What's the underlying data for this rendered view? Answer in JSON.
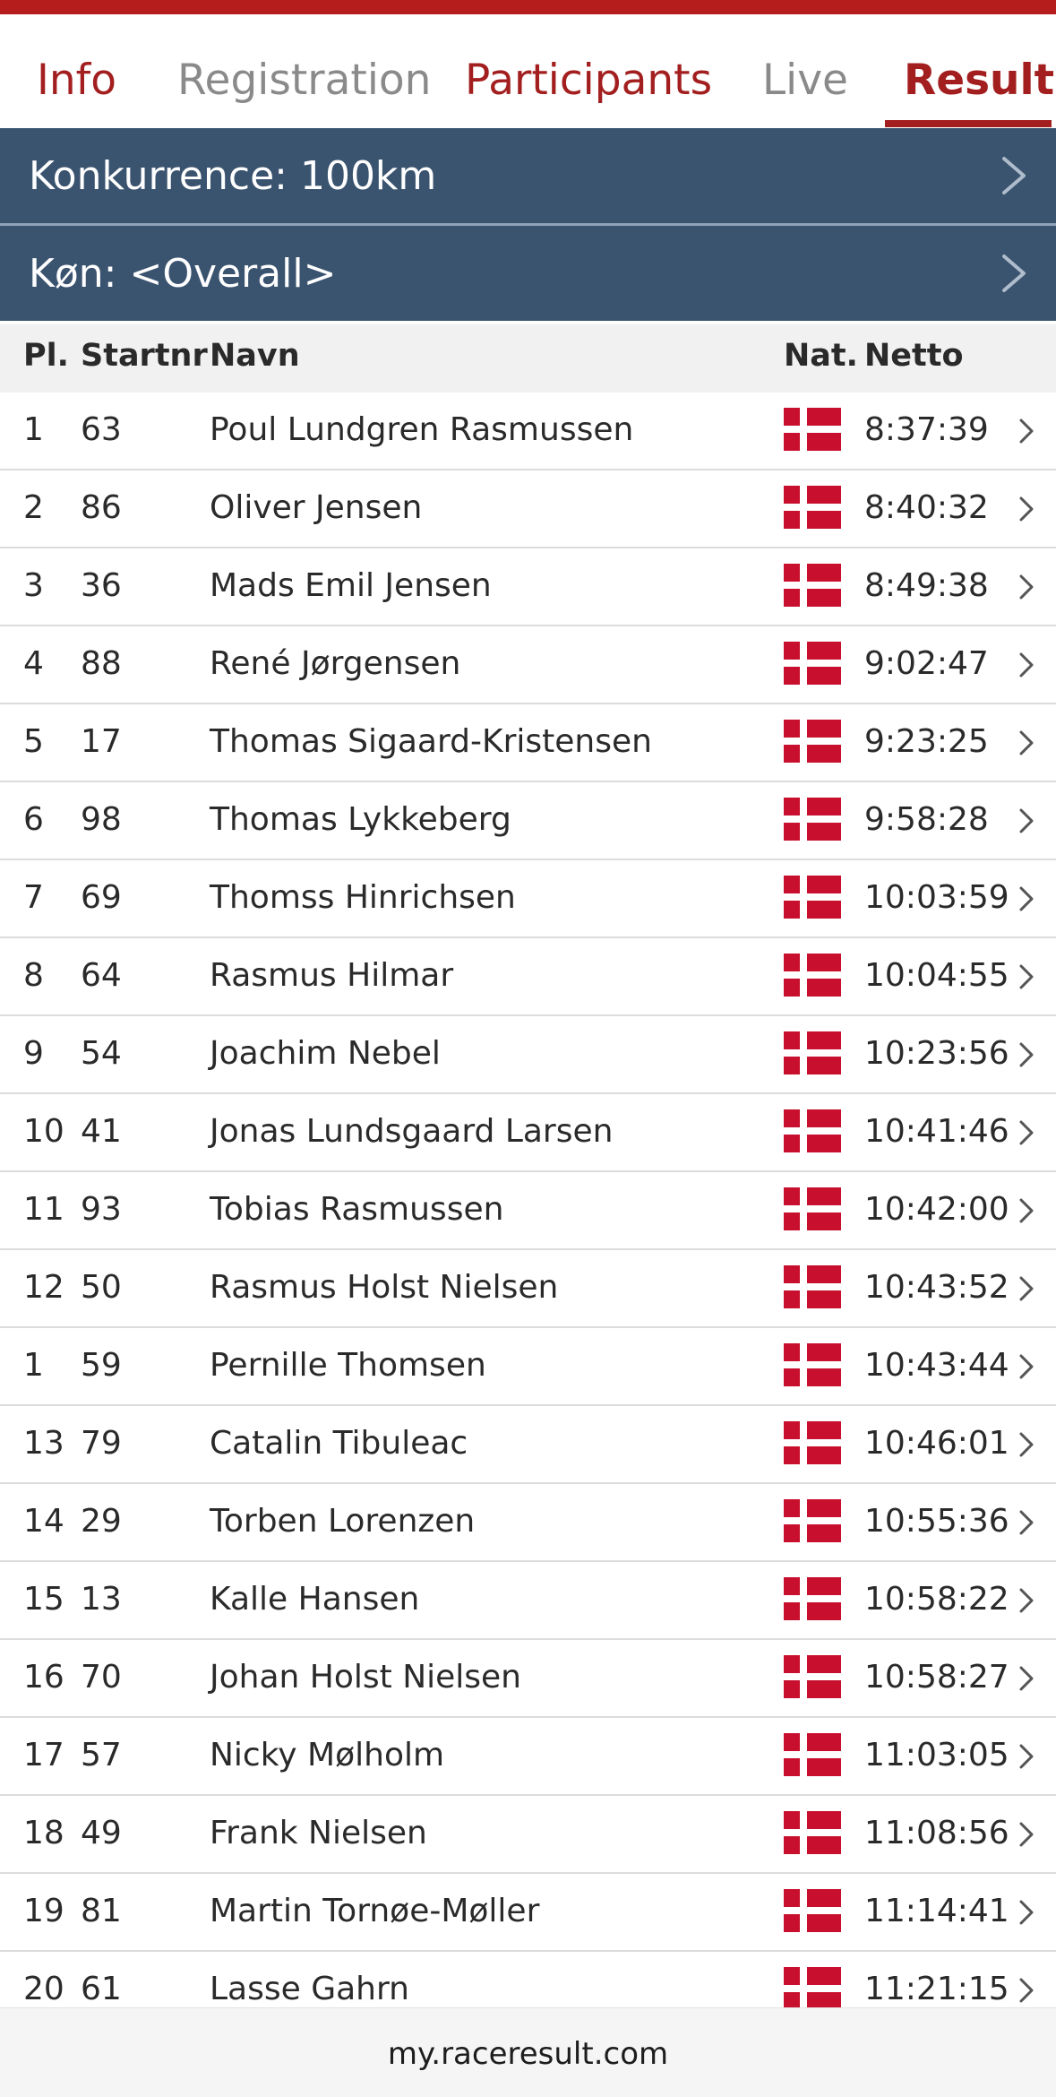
{
  "tabs": [
    {
      "label": "Info",
      "state": "link"
    },
    {
      "label": "Registration",
      "state": "inactive"
    },
    {
      "label": "Participants",
      "state": "link"
    },
    {
      "label": "Live",
      "state": "inactive"
    },
    {
      "label": "Results",
      "state": "active"
    }
  ],
  "selectors": {
    "competition": "Konkurrence: 100km",
    "gender": "Køn: <Overall>"
  },
  "table": {
    "headers": {
      "place": "Pl.",
      "startnr": "Startnr",
      "name": "Navn",
      "nat": "Nat.",
      "netto": "Netto"
    },
    "rows": [
      {
        "place": "1",
        "startnr": "63",
        "name": "Poul Lundgren Rasmussen",
        "nat": "Denmark",
        "time": "8:37:39"
      },
      {
        "place": "2",
        "startnr": "86",
        "name": "Oliver Jensen",
        "nat": "Denmark",
        "time": "8:40:32"
      },
      {
        "place": "3",
        "startnr": "36",
        "name": "Mads Emil Jensen",
        "nat": "Denmark",
        "time": "8:49:38"
      },
      {
        "place": "4",
        "startnr": "88",
        "name": "René Jørgensen",
        "nat": "Denmark",
        "time": "9:02:47"
      },
      {
        "place": "5",
        "startnr": "17",
        "name": "Thomas Sigaard-Kristensen",
        "nat": "Denmark",
        "time": "9:23:25"
      },
      {
        "place": "6",
        "startnr": "98",
        "name": "Thomas Lykkeberg",
        "nat": "Denmark",
        "time": "9:58:28"
      },
      {
        "place": "7",
        "startnr": "69",
        "name": "Thomss Hinrichsen",
        "nat": "Denmark",
        "time": "10:03:59"
      },
      {
        "place": "8",
        "startnr": "64",
        "name": "Rasmus Hilmar",
        "nat": "Denmark",
        "time": "10:04:55"
      },
      {
        "place": "9",
        "startnr": "54",
        "name": "Joachim Nebel",
        "nat": "Denmark",
        "time": "10:23:56"
      },
      {
        "place": "10",
        "startnr": "41",
        "name": "Jonas Lundsgaard Larsen",
        "nat": "Denmark",
        "time": "10:41:46"
      },
      {
        "place": "11",
        "startnr": "93",
        "name": "Tobias Rasmussen",
        "nat": "Denmark",
        "time": "10:42:00"
      },
      {
        "place": "12",
        "startnr": "50",
        "name": "Rasmus Holst Nielsen",
        "nat": "Denmark",
        "time": "10:43:52"
      },
      {
        "place": "1",
        "startnr": "59",
        "name": "Pernille Thomsen",
        "nat": "Denmark",
        "time": "10:43:44"
      },
      {
        "place": "13",
        "startnr": "79",
        "name": "Catalin Tibuleac",
        "nat": "Denmark",
        "time": "10:46:01"
      },
      {
        "place": "14",
        "startnr": "29",
        "name": "Torben Lorenzen",
        "nat": "Denmark",
        "time": "10:55:36"
      },
      {
        "place": "15",
        "startnr": "13",
        "name": "Kalle Hansen",
        "nat": "Denmark",
        "time": "10:58:22"
      },
      {
        "place": "16",
        "startnr": "70",
        "name": "Johan Holst Nielsen",
        "nat": "Denmark",
        "time": "10:58:27"
      },
      {
        "place": "17",
        "startnr": "57",
        "name": "Nicky Mølholm",
        "nat": "Denmark",
        "time": "11:03:05"
      },
      {
        "place": "18",
        "startnr": "49",
        "name": "Frank Nielsen",
        "nat": "Denmark",
        "time": "11:08:56"
      },
      {
        "place": "19",
        "startnr": "81",
        "name": "Martin Tornøe-Møller",
        "nat": "Denmark",
        "time": "11:14:41"
      },
      {
        "place": "20",
        "startnr": "61",
        "name": "Lasse Gahrn",
        "nat": "Denmark",
        "time": "11:21:15"
      }
    ]
  },
  "footer": {
    "url": "my.raceresult.com"
  },
  "icons": {
    "flag": "denmark-flag-icon",
    "chevron": "chevron-right-icon"
  },
  "colors": {
    "accent_red": "#a31f1f",
    "top_bar": "#b51c1c",
    "selector_bg": "#3a536f",
    "inactive_tab": "#8a8a8a",
    "flag_red": "#c8102e"
  }
}
